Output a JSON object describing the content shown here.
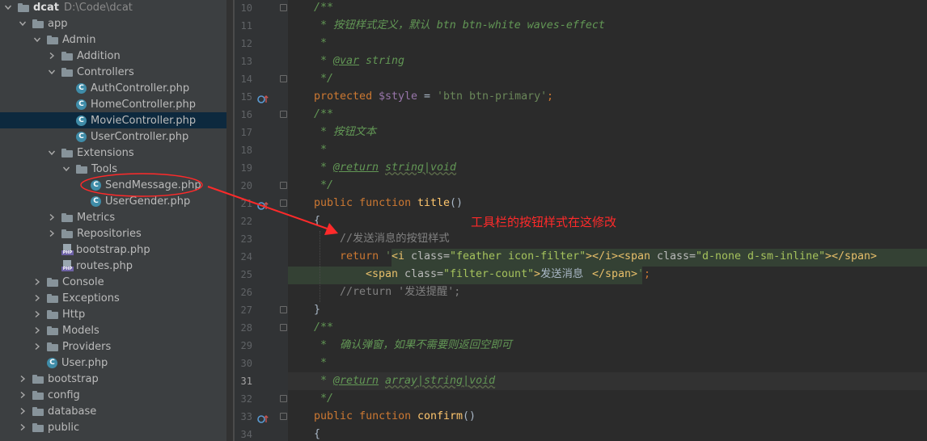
{
  "colors": {
    "tree_bg": "#3c3f41",
    "selected_row": "#0d293e",
    "editor_bg": "#2b2b2b",
    "gutter_bg": "#313335",
    "annotation": "#ff2a2a",
    "keyword": "#cc7832",
    "comment": "#629755",
    "string": "#6a8759",
    "function": "#ffc66d",
    "variable": "#9876aa",
    "html_tag": "#e8bf6a"
  },
  "project_tree": [
    {
      "label": "dcat",
      "path": "D:\\Code\\dcat",
      "icon": "folder-icon",
      "depth": 0,
      "arrow": "down",
      "bold": true
    },
    {
      "label": "app",
      "icon": "folder-icon",
      "depth": 1,
      "arrow": "down"
    },
    {
      "label": "Admin",
      "icon": "folder-icon",
      "depth": 2,
      "arrow": "down"
    },
    {
      "label": "Addition",
      "icon": "folder-icon",
      "depth": 3,
      "arrow": "right"
    },
    {
      "label": "Controllers",
      "icon": "folder-icon",
      "depth": 3,
      "arrow": "down"
    },
    {
      "label": "AuthController.php",
      "icon": "php-class-icon",
      "depth": 4,
      "arrow": "none"
    },
    {
      "label": "HomeController.php",
      "icon": "php-class-icon",
      "depth": 4,
      "arrow": "none"
    },
    {
      "label": "MovieController.php",
      "icon": "php-class-icon",
      "depth": 4,
      "arrow": "none",
      "selected": true
    },
    {
      "label": "UserController.php",
      "icon": "php-class-icon",
      "depth": 4,
      "arrow": "none"
    },
    {
      "label": "Extensions",
      "icon": "folder-icon",
      "depth": 3,
      "arrow": "down"
    },
    {
      "label": "Tools",
      "icon": "folder-icon",
      "depth": 4,
      "arrow": "down"
    },
    {
      "label": "SendMessage.php",
      "icon": "php-class-icon",
      "depth": 5,
      "arrow": "none"
    },
    {
      "label": "UserGender.php",
      "icon": "php-class-icon",
      "depth": 5,
      "arrow": "none"
    },
    {
      "label": "Metrics",
      "icon": "folder-icon",
      "depth": 3,
      "arrow": "right"
    },
    {
      "label": "Repositories",
      "icon": "folder-icon",
      "depth": 3,
      "arrow": "right"
    },
    {
      "label": "bootstrap.php",
      "icon": "php-file-icon",
      "depth": 3,
      "arrow": "none"
    },
    {
      "label": "routes.php",
      "icon": "php-file-icon",
      "depth": 3,
      "arrow": "none"
    },
    {
      "label": "Console",
      "icon": "folder-icon",
      "depth": 2,
      "arrow": "right"
    },
    {
      "label": "Exceptions",
      "icon": "folder-icon",
      "depth": 2,
      "arrow": "right"
    },
    {
      "label": "Http",
      "icon": "folder-icon",
      "depth": 2,
      "arrow": "right"
    },
    {
      "label": "Models",
      "icon": "folder-icon",
      "depth": 2,
      "arrow": "right"
    },
    {
      "label": "Providers",
      "icon": "folder-icon",
      "depth": 2,
      "arrow": "right"
    },
    {
      "label": "User.php",
      "icon": "php-class-icon",
      "depth": 2,
      "arrow": "none"
    },
    {
      "label": "bootstrap",
      "icon": "folder-icon",
      "depth": 1,
      "arrow": "right"
    },
    {
      "label": "config",
      "icon": "folder-icon",
      "depth": 1,
      "arrow": "right"
    },
    {
      "label": "database",
      "icon": "folder-icon",
      "depth": 1,
      "arrow": "right"
    },
    {
      "label": "public",
      "icon": "folder-icon",
      "depth": 1,
      "arrow": "right"
    }
  ],
  "editor": {
    "current_line": "31",
    "lines": [
      {
        "no": "10",
        "fold": true,
        "tokens": [
          {
            "t": "    /**",
            "c": "cm"
          }
        ]
      },
      {
        "no": "11",
        "tokens": [
          {
            "t": "     * 按钮样式定义，默认 btn btn-white waves-effect",
            "c": "cm"
          }
        ]
      },
      {
        "no": "12",
        "tokens": [
          {
            "t": "     *",
            "c": "cm"
          }
        ]
      },
      {
        "no": "13",
        "tokens": [
          {
            "t": "     * ",
            "c": "cm"
          },
          {
            "t": "@var",
            "c": "cmu"
          },
          {
            "t": " string",
            "c": "cm"
          }
        ]
      },
      {
        "no": "14",
        "fold": true,
        "tokens": [
          {
            "t": "     */",
            "c": "cm"
          }
        ]
      },
      {
        "no": "15",
        "override": true,
        "tokens": [
          {
            "t": "    protected ",
            "c": "kw"
          },
          {
            "t": "$style",
            "c": "var"
          },
          {
            "t": " = ",
            "c": "plain"
          },
          {
            "t": "'btn btn-primary'",
            "c": "str"
          },
          {
            "t": ";",
            "c": "kw"
          }
        ]
      },
      {
        "no": "16",
        "fold": true,
        "tokens": [
          {
            "t": "    /**",
            "c": "cm"
          }
        ]
      },
      {
        "no": "17",
        "tokens": [
          {
            "t": "     * 按钮文本",
            "c": "cm"
          }
        ]
      },
      {
        "no": "18",
        "tokens": [
          {
            "t": "     *",
            "c": "cm"
          }
        ]
      },
      {
        "no": "19",
        "tokens": [
          {
            "t": "     * ",
            "c": "cm"
          },
          {
            "t": "@return",
            "c": "cmu"
          },
          {
            "t": " ",
            "c": "cm"
          },
          {
            "t": "string|void",
            "c": "cmt"
          }
        ]
      },
      {
        "no": "20",
        "fold": true,
        "tokens": [
          {
            "t": "     */",
            "c": "cm"
          }
        ]
      },
      {
        "no": "21",
        "override": true,
        "fold": true,
        "tokens": [
          {
            "t": "    public function ",
            "c": "kw"
          },
          {
            "t": "title",
            "c": "fn"
          },
          {
            "t": "()",
            "c": "plain"
          }
        ]
      },
      {
        "no": "22",
        "tokens": [
          {
            "t": "    {",
            "c": "plain"
          }
        ]
      },
      {
        "no": "23",
        "tokens": [
          {
            "t": "        //发送消息的按钮样式",
            "c": "lc"
          }
        ]
      },
      {
        "no": "24",
        "tokens": [
          {
            "t": "        return ",
            "c": "kw"
          },
          {
            "t": "'",
            "c": "str"
          },
          {
            "t": "<i ",
            "c": "tg"
          },
          {
            "t": "class=",
            "c": "at"
          },
          {
            "t": "\"feather icon-filter\"",
            "c": "av"
          },
          {
            "t": "></i><span ",
            "c": "tg"
          },
          {
            "t": "class=",
            "c": "at"
          },
          {
            "t": "\"d-none d-sm-inline\"",
            "c": "av"
          },
          {
            "t": "></span>",
            "c": "tg"
          }
        ]
      },
      {
        "no": "25",
        "tokens": [
          {
            "t": "            ",
            "c": "plain"
          },
          {
            "t": "<span ",
            "c": "tg"
          },
          {
            "t": "class=",
            "c": "at"
          },
          {
            "t": "\"filter-count\"",
            "c": "av"
          },
          {
            "t": ">",
            "c": "tg"
          },
          {
            "t": "发送消息",
            "c": "plain"
          },
          {
            "t": "</span>",
            "c": "tg"
          },
          {
            "t": "'",
            "c": "str"
          },
          {
            "t": ";",
            "c": "kw"
          }
        ]
      },
      {
        "no": "26",
        "tokens": [
          {
            "t": "        //return '发送提醒';",
            "c": "lc"
          }
        ]
      },
      {
        "no": "27",
        "fold": true,
        "tokens": [
          {
            "t": "    }",
            "c": "plain"
          }
        ]
      },
      {
        "no": "28",
        "fold": true,
        "tokens": [
          {
            "t": "    /**",
            "c": "cm"
          }
        ]
      },
      {
        "no": "29",
        "tokens": [
          {
            "t": "     *  确认弹窗，如果不需要则返回空即可",
            "c": "cm"
          }
        ]
      },
      {
        "no": "30",
        "tokens": [
          {
            "t": "     *",
            "c": "cm"
          }
        ]
      },
      {
        "no": "31",
        "bulb": true,
        "tokens": [
          {
            "t": "     * ",
            "c": "cm"
          },
          {
            "t": "@return",
            "c": "cmu"
          },
          {
            "t": " ",
            "c": "cm"
          },
          {
            "t": "array|string|void",
            "c": "cmt"
          }
        ]
      },
      {
        "no": "32",
        "fold": true,
        "tokens": [
          {
            "t": "     */",
            "c": "cm"
          }
        ]
      },
      {
        "no": "33",
        "override": true,
        "fold": true,
        "tokens": [
          {
            "t": "    public function ",
            "c": "kw"
          },
          {
            "t": "confirm",
            "c": "fn"
          },
          {
            "t": "()",
            "c": "plain"
          }
        ]
      },
      {
        "no": "34",
        "tokens": [
          {
            "t": "    {",
            "c": "plain"
          }
        ]
      }
    ]
  },
  "annotation": {
    "text": "工具栏的按钮样式在这修改"
  }
}
